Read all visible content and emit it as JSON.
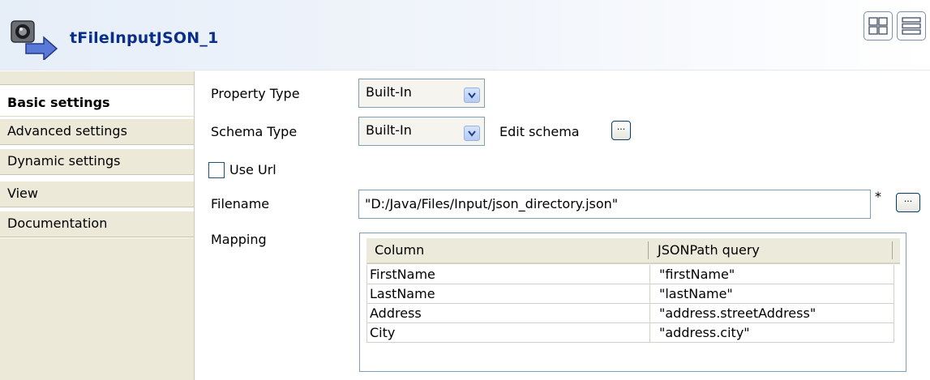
{
  "component": {
    "title": "tFileInputJSON_1",
    "icon": "file-input-json-icon"
  },
  "view_toggle": {
    "icons": [
      "grid-view-icon",
      "list-view-icon"
    ]
  },
  "sidebar": {
    "tabs": [
      {
        "label": "Basic settings",
        "active": true
      },
      {
        "label": "Advanced settings",
        "active": false
      },
      {
        "label": "Dynamic settings",
        "active": false
      },
      {
        "label": "View",
        "active": false
      },
      {
        "label": "Documentation",
        "active": false
      }
    ]
  },
  "form": {
    "property_type": {
      "label": "Property Type",
      "value": "Built-In"
    },
    "schema_type": {
      "label": "Schema Type",
      "value": "Built-In",
      "edit_label": "Edit schema"
    },
    "use_url": {
      "label": "Use Url",
      "checked": false
    },
    "filename": {
      "label": "Filename",
      "value": "\"D:/Java/Files/Input/json_directory.json\"",
      "required_marker": "*"
    },
    "mapping": {
      "label": "Mapping",
      "columns": [
        "Column",
        "JSONPath query"
      ],
      "rows": [
        [
          "FirstName",
          "\"firstName\""
        ],
        [
          "LastName",
          "\"lastName\""
        ],
        [
          "Address",
          "\"address.streetAddress\""
        ],
        [
          "City",
          "\"address.city\""
        ]
      ]
    },
    "browse_label": "..."
  },
  "colors": {
    "title": "#0a2f8a",
    "sidebar_bg": "#ece9d8",
    "control_border": "#7f9db9"
  }
}
